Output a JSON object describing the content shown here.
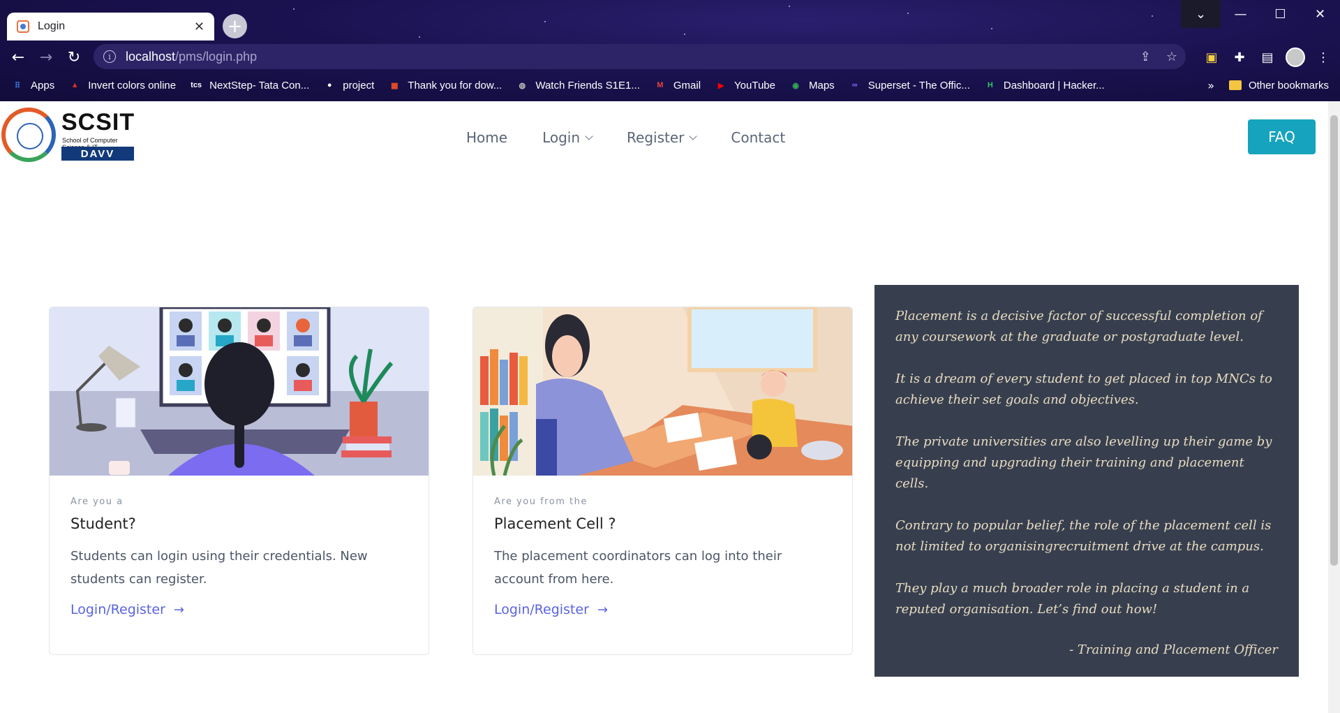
{
  "browser": {
    "tab_title": "Login",
    "tab_close": "✕",
    "new_tab": "+",
    "url_host": "localhost",
    "url_path": "/pms/login.php",
    "bookmarks": [
      {
        "label": "Apps",
        "icon": "apps-grid-icon",
        "color": "#4285f4"
      },
      {
        "label": "Invert colors online",
        "icon": "tree-icon",
        "color": "#d93025"
      },
      {
        "label": "NextStep- Tata Con...",
        "icon": "tcs-icon",
        "color": "#ffffff"
      },
      {
        "label": "project",
        "icon": "github-icon",
        "color": "#ffffff"
      },
      {
        "label": "Thank you for dow...",
        "icon": "microsoft-icon",
        "color": "#f25022"
      },
      {
        "label": "Watch Friends S1E1...",
        "icon": "globe-icon",
        "color": "#bdbdbd"
      },
      {
        "label": "Gmail",
        "icon": "gmail-icon",
        "color": "#ea4335"
      },
      {
        "label": "YouTube",
        "icon": "youtube-icon",
        "color": "#ff0000"
      },
      {
        "label": "Maps",
        "icon": "maps-pin-icon",
        "color": "#34a853"
      },
      {
        "label": "Superset - The Offic...",
        "icon": "superset-icon",
        "color": "#7b6cff"
      },
      {
        "label": "Dashboard | Hacker...",
        "icon": "hackerrank-icon",
        "color": "#2ec866"
      }
    ],
    "more_bookmarks": "»",
    "other_bookmarks": "Other bookmarks"
  },
  "site": {
    "logo_name": "SCSIT",
    "logo_sub": "School of Computer Science & IT",
    "logo_badge": "DAVV",
    "nav": {
      "home": "Home",
      "login": "Login",
      "register": "Register",
      "contact": "Contact"
    },
    "faq": "FAQ"
  },
  "cards": [
    {
      "kicker": "Are you a",
      "title": "Student?",
      "desc": "Students can login using their credentials. New students can register.",
      "link": "Login/Register"
    },
    {
      "kicker": "Are you from the",
      "title": "Placement Cell ?",
      "desc": "The placement coordinators can log into their account from here.",
      "link": "Login/Register"
    }
  ],
  "quote": {
    "p1": "Placement is a decisive factor of successful completion of any coursework at the graduate or postgraduate level.",
    "p2": "It is a dream of every student to get placed in top MNCs to achieve their set goals and objectives.",
    "p3": "The private universities are also levelling up their game by equipping and upgrading their training and placement cells.",
    "p4": "Contrary to popular belief, the role of the placement cell is not limited to organisingrecruitment drive at the campus.",
    "p5": "They play a much broader role in placing a student in a reputed organisation. Let’s find out how!",
    "signature": "- Training and Placement Officer"
  }
}
